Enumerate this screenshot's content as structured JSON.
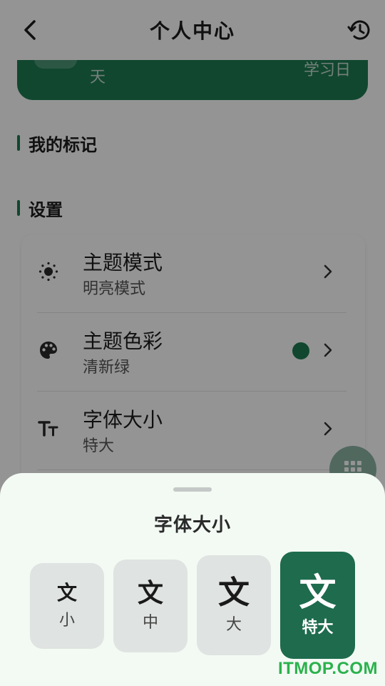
{
  "header": {
    "title": "个人中心",
    "back_icon": "chevron-left-icon",
    "history_icon": "history-icon"
  },
  "banner": {
    "days_unit": "天",
    "study_day": "学习日"
  },
  "sections": {
    "marks": "我的标记",
    "settings": "设置"
  },
  "settings": {
    "items": [
      {
        "name": "主题模式",
        "value": "明亮模式",
        "icon": "brightness-icon"
      },
      {
        "name": "主题色彩",
        "value": "清新绿",
        "icon": "palette-icon",
        "swatch": "#1e7a52"
      },
      {
        "name": "字体大小",
        "value": "特大",
        "icon": "text-size-icon"
      }
    ]
  },
  "fab": {
    "icon": "grid-icon"
  },
  "sheet": {
    "title": "字体大小",
    "options": [
      {
        "glyph": "文",
        "label": "小",
        "selected": false
      },
      {
        "glyph": "文",
        "label": "中",
        "selected": false
      },
      {
        "glyph": "文",
        "label": "大",
        "selected": false
      },
      {
        "glyph": "文",
        "label": "特大",
        "selected": true
      }
    ]
  },
  "watermark": "ITMOP.COM",
  "colors": {
    "accent": "#1e7a52",
    "selected_option": "#1e6b4e",
    "option_bg": "#dfe3e1",
    "sheet_bg": "#f3faf4",
    "watermark": "#2bb24c"
  }
}
